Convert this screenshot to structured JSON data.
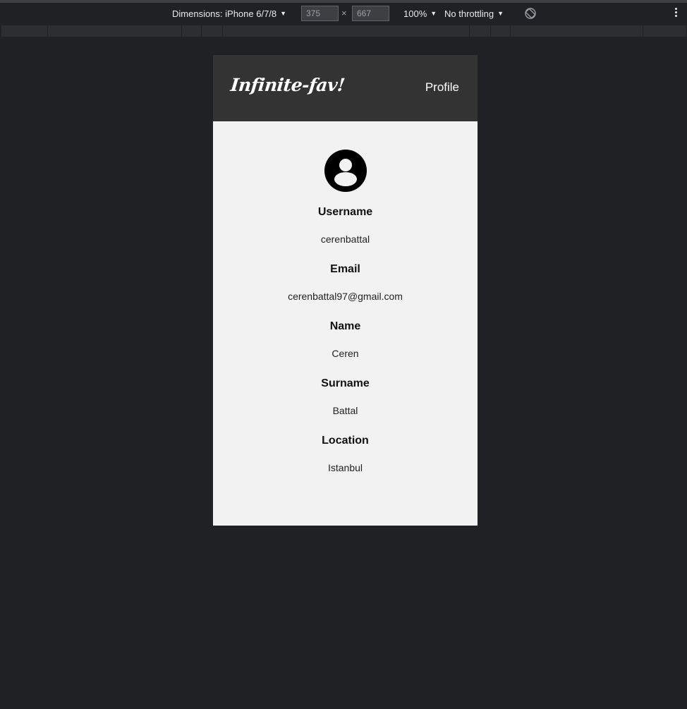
{
  "devtools": {
    "dimensions_label": "Dimensions: iPhone 6/7/8",
    "width_value": "375",
    "height_value": "667",
    "times_symbol": "×",
    "zoom": "100%",
    "throttling": "No throttling",
    "caret": "▼"
  },
  "app": {
    "brand": "Infinite-fav!",
    "nav_link": "Profile"
  },
  "profile": {
    "fields": [
      {
        "label": "Username",
        "value": "cerenbattal"
      },
      {
        "label": "Email",
        "value": "cerenbattal97@gmail.com"
      },
      {
        "label": "Name",
        "value": "Ceren"
      },
      {
        "label": "Surname",
        "value": "Battal"
      },
      {
        "label": "Location",
        "value": "Istanbul"
      }
    ]
  }
}
